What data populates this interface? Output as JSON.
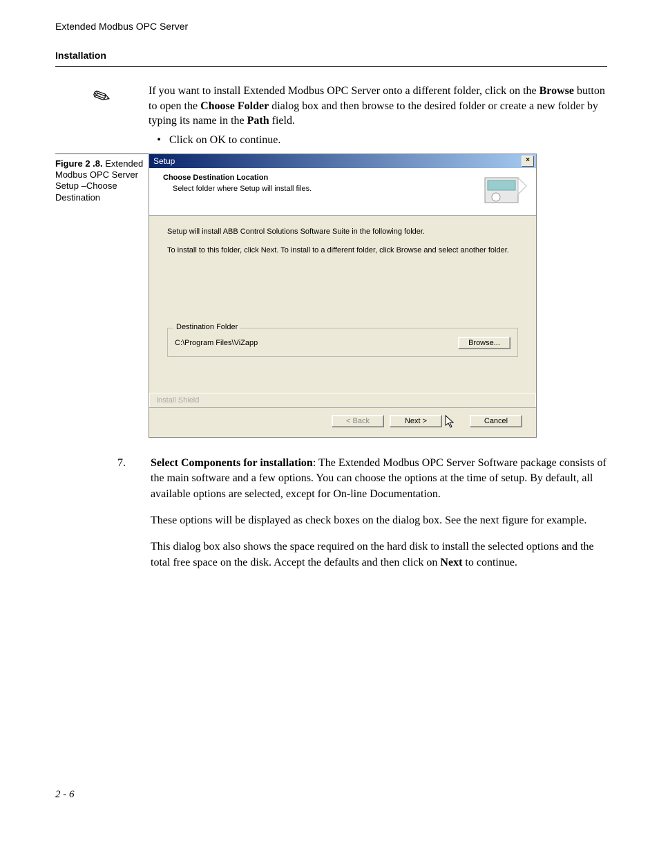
{
  "header": {
    "product": "Extended Modbus OPC Server",
    "section": "Installation"
  },
  "note": {
    "text_pre": "If you want to install Extended Modbus OPC Server onto a different folder, click on the ",
    "bold1": "Browse",
    "text_mid1": " button to open the ",
    "bold2": "Choose Folder",
    "text_mid2": " dialog box and then browse to the desired folder or create a new folder by typing its name in the ",
    "bold3": "Path",
    "text_end": " field."
  },
  "bullet": {
    "text": "Click on OK to continue."
  },
  "figure": {
    "number": "Figure 2 .8.",
    "caption": "Extended Modbus OPC Server Setup –Choose Destination"
  },
  "dialog": {
    "title": "Setup",
    "close": "×",
    "heading": "Choose Destination Location",
    "subheading": "Select folder where Setup will install files.",
    "body1": "Setup will install ABB Control Solutions Software Suite in the following folder.",
    "body2": "To install to this folder, click Next. To install to a different folder, click Browse and select another folder.",
    "fieldset_legend": "Destination Folder",
    "path": "C:\\Program Files\\ViZapp",
    "browse": "Browse...",
    "shield": "Install Shield",
    "back": "< Back",
    "next": "Next >",
    "cancel": "Cancel"
  },
  "step": {
    "num": "7.",
    "bold_lead": "Select Components for installation",
    "p1_tail": ": The Extended Modbus OPC Server Software package consists of the main software and a few options. You can choose the options at the time of setup. By default, all available options are selected, except for On-line Documentation.",
    "p2": "These options will be displayed as check boxes on the dialog box. See the next figure for example.",
    "p3_pre": "This dialog box also shows the space required on the hard disk to install the selected options and the total free space on the disk. Accept the defaults and then click on ",
    "p3_bold": "Next",
    "p3_post": " to continue."
  },
  "footer": {
    "page": "2 - 6"
  }
}
